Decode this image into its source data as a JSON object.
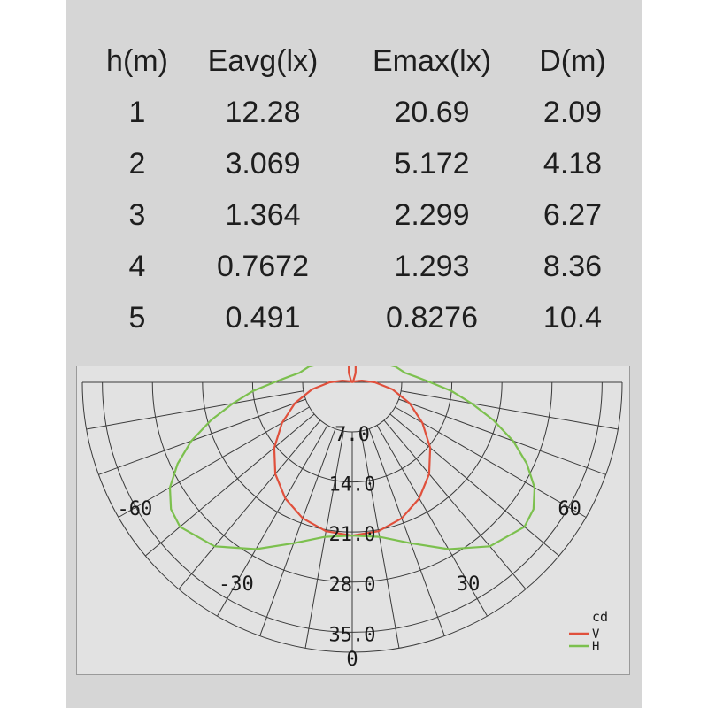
{
  "table": {
    "headers": [
      "h(m)",
      "Eavg(lx)",
      "Emax(lx)",
      "D(m)"
    ],
    "rows": [
      [
        "1",
        "12.28",
        "20.69",
        "2.09"
      ],
      [
        "2",
        "3.069",
        "5.172",
        "4.18"
      ],
      [
        "3",
        "1.364",
        "2.299",
        "6.27"
      ],
      [
        "4",
        "0.7672",
        "1.293",
        "8.36"
      ],
      [
        "5",
        "0.491",
        "0.8276",
        "10.4"
      ]
    ]
  },
  "chart_data": {
    "type": "polar",
    "radial_ticks": [
      "7.0",
      "14.0",
      "21.0",
      "28.0",
      "35.0"
    ],
    "radial_values": [
      7,
      14,
      21,
      28,
      35
    ],
    "radial_max": 35,
    "angle_labels": [
      {
        "angle": -60,
        "label": "-60"
      },
      {
        "angle": -30,
        "label": "-30"
      },
      {
        "angle": 0,
        "label": "0"
      },
      {
        "angle": 30,
        "label": "30"
      },
      {
        "angle": 60,
        "label": "60"
      }
    ],
    "grid_angle_step": 10,
    "unit_label": "cd",
    "series": [
      {
        "name": "V",
        "color": "#e0503c",
        "angles": [
          0,
          10,
          20,
          30,
          40,
          50,
          60,
          70,
          80,
          90,
          100,
          110,
          120,
          130,
          140,
          150,
          160,
          170,
          180
        ],
        "values": [
          21.5,
          21.2,
          20.3,
          18.8,
          16.8,
          14.3,
          11.4,
          8.6,
          5.8,
          3.2,
          1.4,
          0.4,
          0.1,
          0.05,
          0.1,
          0.4,
          1.4,
          2.8,
          3.1
        ]
      },
      {
        "name": "H",
        "color": "#7cc04e",
        "angles": [
          0,
          10,
          20,
          30,
          40,
          50,
          55,
          60,
          65,
          70,
          75,
          80,
          85,
          90,
          95,
          100,
          110,
          120,
          130,
          140,
          150,
          160,
          170,
          180
        ],
        "values": [
          21.5,
          22.0,
          24.0,
          27.0,
          30.0,
          31.5,
          31.0,
          29.5,
          27.0,
          24.0,
          20.5,
          17.0,
          14.0,
          11.0,
          9.0,
          7.6,
          6.5,
          5.2,
          4.3,
          3.6,
          3.2,
          3.0,
          3.0,
          3.1
        ]
      }
    ]
  }
}
